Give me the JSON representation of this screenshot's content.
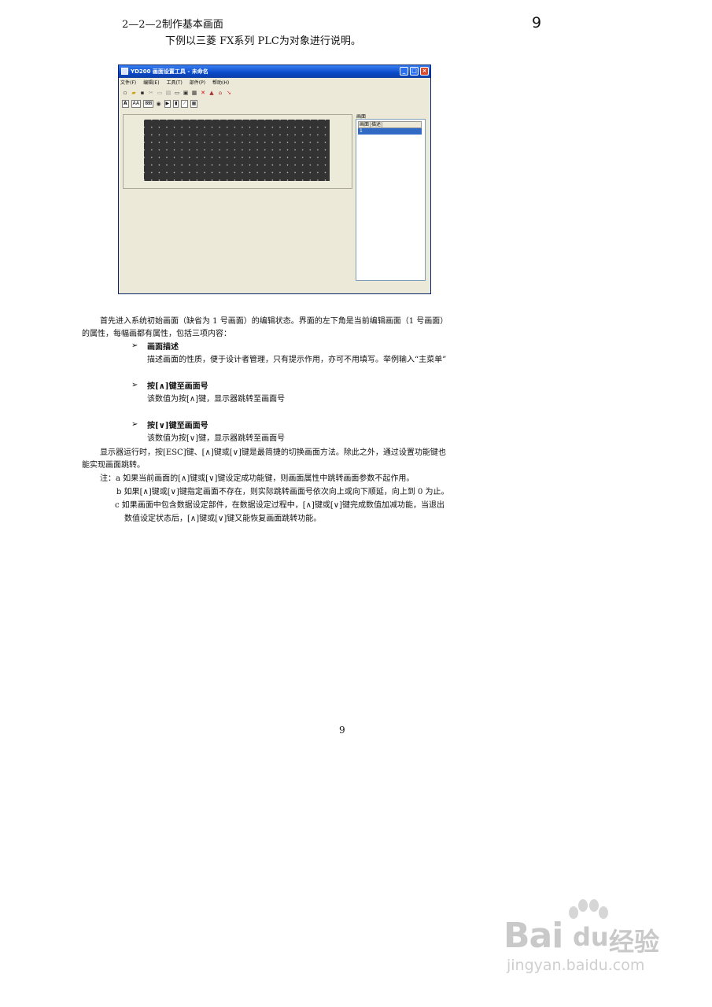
{
  "header": {
    "title": "2—2—2制作基本画面",
    "subtitle": "下例以三菱 FX系列 PLC为对象进行说明。",
    "corner_page": "9"
  },
  "window": {
    "title": "YD200 画面设置工具 - 未命名",
    "menu": [
      "文件(F)",
      "编辑(E)",
      "工具(T)",
      "部件(P)",
      "帮助(H)"
    ],
    "toolbar2_labels": [
      "A",
      "AA",
      "888"
    ],
    "panel_title": "画面",
    "panel_columns": [
      "画面",
      "描述"
    ],
    "panel_row": "1",
    "lcd_color": "#333333",
    "selection_color": "#316ac5"
  },
  "body": {
    "intro_line1": "首先进入系统初始画面（缺省为 1 号画面）的编辑状态。界面的左下角是当前编辑画面（1 号画面）",
    "intro_line2": "的属性，每幅画都有属性，包括三项内容：",
    "bullets": [
      {
        "marker": "➢",
        "title": "画面描述",
        "desc": "描述画面的性质，便于设计者管理，只有提示作用，亦可不用填写。举例输入“主菜单”"
      },
      {
        "marker": "➢",
        "title": "按[∧]键至画面号",
        "desc": "该数值为按[∧]键，显示器跳转至画面号"
      },
      {
        "marker": "➢",
        "title": "按[∨]键至画面号",
        "desc": "该数值为按[∨]键，显示器跳转至画面号"
      }
    ],
    "run_line1": "显示器运行时，按[ESC]键、[∧]键或[∨]键是最简捷的切换画面方法。除此之外，通过设置功能键也",
    "run_line2": "能实现画面跳转。",
    "notes": {
      "a": "注：a  如果当前画面的[∧]键或[∨]键设定成功能键，则画面属性中跳转画面参数不起作用。",
      "b": "b  如果[∧]键或[∨]键指定画面不存在，则实际跳转画面号依次向上或向下顺延，向上到 0 为止。",
      "c1": "c  如果画面中包含数据设定部件，在数据设定过程中，[∧]键或[∨]键完成数值加减功能，当退出",
      "c2": "数值设定状态后，[∧]键或[∨]键又能恢复画面跳转功能。"
    }
  },
  "footer": {
    "page_number": "9"
  },
  "watermark": {
    "brand": "Bai",
    "brand2": "du",
    "cn": "经验",
    "url": "jingyan.baidu.com"
  }
}
